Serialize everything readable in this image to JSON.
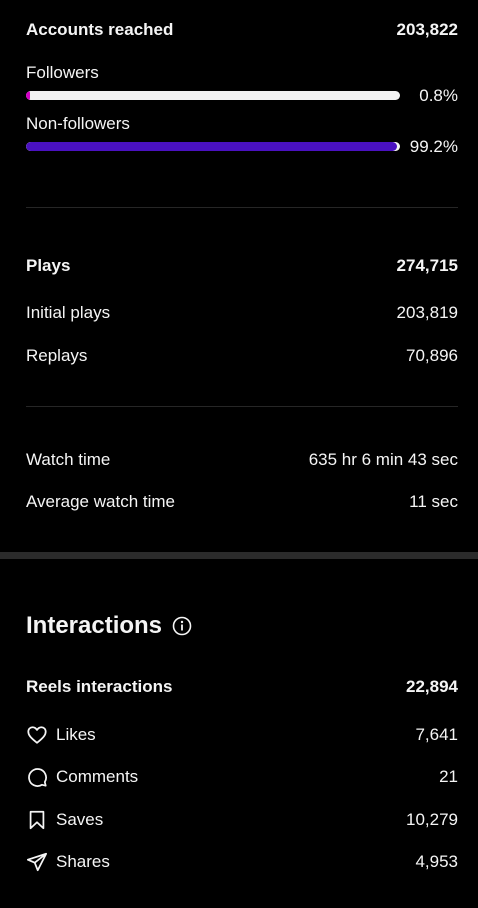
{
  "reach": {
    "title": "Accounts reached",
    "total": "203,822",
    "followers": {
      "label": "Followers",
      "value": "0.8%",
      "fraction": 0.008,
      "color": "#d300c5"
    },
    "non_followers": {
      "label": "Non-followers",
      "value": "99.2%",
      "fraction": 0.992,
      "color": "#4a11c0"
    }
  },
  "plays": {
    "title": "Plays",
    "total": "274,715",
    "initial": {
      "label": "Initial plays",
      "value": "203,819"
    },
    "replays": {
      "label": "Replays",
      "value": "70,896"
    }
  },
  "watch": {
    "watch_time": {
      "label": "Watch time",
      "value": "635 hr 6 min 43 sec"
    },
    "avg_watch_time": {
      "label": "Average watch time",
      "value": "11 sec"
    }
  },
  "interactions": {
    "title": "Interactions",
    "info_icon": "info-icon",
    "reels": {
      "label": "Reels interactions",
      "value": "22,894"
    },
    "likes": {
      "label": "Likes",
      "value": "7,641",
      "icon": "heart-icon"
    },
    "comments": {
      "label": "Comments",
      "value": "21",
      "icon": "comment-icon"
    },
    "saves": {
      "label": "Saves",
      "value": "10,279",
      "icon": "bookmark-icon"
    },
    "shares": {
      "label": "Shares",
      "value": "4,953",
      "icon": "send-icon"
    }
  }
}
